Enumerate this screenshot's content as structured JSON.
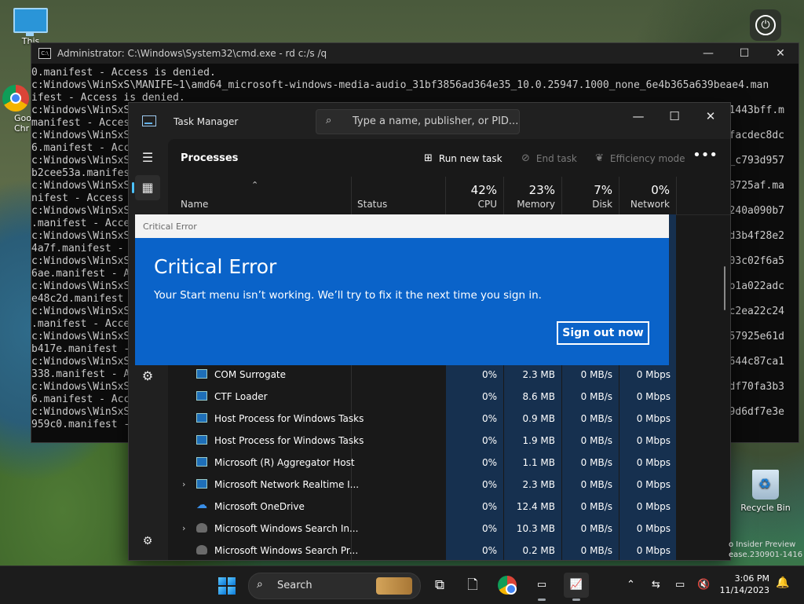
{
  "desktop": {
    "icons": [
      {
        "label": "This"
      },
      {
        "label": "Goo\nChr"
      },
      {
        "label": "Recycle Bin"
      }
    ],
    "watermark_lines": [
      "o Insider Preview",
      "ease.230901-1416"
    ]
  },
  "cmd": {
    "title": "Administrator: C:\\Windows\\System32\\cmd.exe - rd  c:/s /q",
    "lines": [
      "0.manifest - Access is denied.",
      "c:Windows\\WinSxS\\MANIFE~1\\amd64_microsoft-windows-media-audio_31bf3856ad364e35_10.0.25947.1000_none_6e4b365a639beae4.man",
      "ifest - Access is denied.",
      "c:Windows\\WinSxS",
      "manifest - Access",
      "c:Windows\\WinSxS",
      "6.manifest - Acc",
      "c:Windows\\WinSxS",
      "b2cee53a.manifes",
      "c:Windows\\WinSxS",
      "nifest - Access",
      "c:Windows\\WinSxS",
      ".manifest - Acce",
      "c:Windows\\WinSxS",
      "4a7f.manifest -",
      "c:Windows\\WinSxS",
      "6ae.manifest - A",
      "c:Windows\\WinSxS",
      "e48c2d.manifest",
      "c:Windows\\WinSxS",
      ".manifest - Acce",
      "c:Windows\\WinSxS",
      "b417e.manifest -",
      "c:Windows\\WinSxS",
      "338.manifest - A",
      "c:Windows\\WinSxS",
      "6.manifest - Acc",
      "c:Windows\\WinSxS",
      "959c0.manifest -"
    ],
    "tails": [
      "1443bff.m",
      "facdec8dc",
      "_c793d957",
      "8725af.ma",
      "240a090b7",
      "d3b4f28e2",
      "03c02f6a5",
      "b1a022adc",
      "c2ea22c24",
      "57925e61d",
      "644c87ca1",
      "df70fa3b3",
      "9d6df7e3e"
    ]
  },
  "taskmanager": {
    "title": "Task Manager",
    "search_placeholder": "Type a name, publisher, or PID...",
    "heading": "Processes",
    "toolbar": {
      "run_new_task": "Run new task",
      "end_task": "End task",
      "efficiency_mode": "Efficiency mode",
      "more": "•••"
    },
    "columns": {
      "name": "Name",
      "status": "Status",
      "cpu_pct": "42%",
      "cpu": "CPU",
      "memory_pct": "23%",
      "memory": "Memory",
      "disk_pct": "7%",
      "disk": "Disk",
      "network_pct": "0%",
      "network": "Network"
    },
    "processes": [
      {
        "name": "COM Surrogate",
        "cpu": "0%",
        "memory": "2.3 MB",
        "disk": "0 MB/s",
        "network": "0 Mbps",
        "expand": ""
      },
      {
        "name": "CTF Loader",
        "cpu": "0%",
        "memory": "8.6 MB",
        "disk": "0 MB/s",
        "network": "0 Mbps",
        "expand": ""
      },
      {
        "name": "Host Process for Windows Tasks",
        "cpu": "0%",
        "memory": "0.9 MB",
        "disk": "0 MB/s",
        "network": "0 Mbps",
        "expand": ""
      },
      {
        "name": "Host Process for Windows Tasks",
        "cpu": "0%",
        "memory": "1.9 MB",
        "disk": "0 MB/s",
        "network": "0 Mbps",
        "expand": ""
      },
      {
        "name": "Microsoft (R) Aggregator Host",
        "cpu": "0%",
        "memory": "1.1 MB",
        "disk": "0 MB/s",
        "network": "0 Mbps",
        "expand": ""
      },
      {
        "name": "Microsoft Network Realtime I...",
        "cpu": "0%",
        "memory": "2.3 MB",
        "disk": "0 MB/s",
        "network": "0 Mbps",
        "expand": "›"
      },
      {
        "name": "Microsoft OneDrive",
        "cpu": "0%",
        "memory": "12.4 MB",
        "disk": "0 MB/s",
        "network": "0 Mbps",
        "expand": ""
      },
      {
        "name": "Microsoft Windows Search In...",
        "cpu": "0%",
        "memory": "10.3 MB",
        "disk": "0 MB/s",
        "network": "0 Mbps",
        "expand": "›"
      },
      {
        "name": "Microsoft Windows Search Pr...",
        "cpu": "0%",
        "memory": "0.2 MB",
        "disk": "0 MB/s",
        "network": "0 Mbps",
        "expand": ""
      }
    ]
  },
  "critical_error": {
    "bar_title": "Critical Error",
    "heading": "Critical Error",
    "message": "Your Start menu isn’t working. We’ll try to fix it the next time you sign in.",
    "button": "Sign out now"
  },
  "taskbar": {
    "search_label": "Search",
    "time": "3:06 PM",
    "date": "11/14/2023"
  },
  "colors": {
    "accent": "#0a63c9",
    "taskbar": "#1c1c1c"
  }
}
